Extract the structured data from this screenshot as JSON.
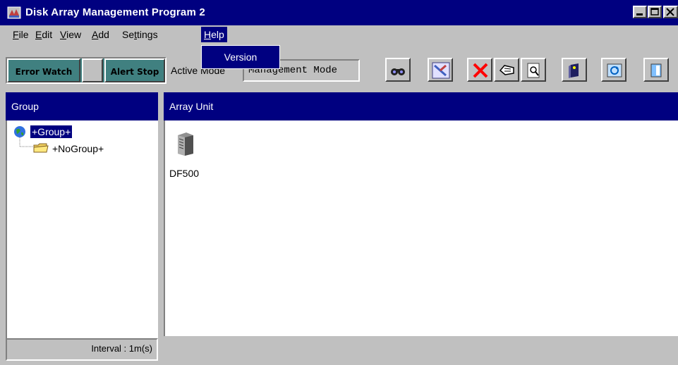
{
  "window": {
    "title": "Disk Array Management Program 2",
    "controls": [
      "minimize-icon",
      "maximize-icon",
      "close-icon"
    ]
  },
  "menubar": {
    "items": [
      {
        "label": "File",
        "mnemonic": "F"
      },
      {
        "label": "Edit",
        "mnemonic": "E"
      },
      {
        "label": "View",
        "mnemonic": "V"
      },
      {
        "label": "Add",
        "mnemonic": "A"
      },
      {
        "label": "Settings",
        "mnemonic": "t"
      },
      {
        "label": "Help",
        "mnemonic": "H"
      }
    ],
    "open_menu": "Help",
    "dropdown": {
      "items": [
        "Version"
      ]
    }
  },
  "toolbar": {
    "error_watch": "Error Watch",
    "alert_stop": "Alert Stop",
    "active_mode_label": "Active Mode",
    "active_mode_value": "Management Mode",
    "buttons": [
      "search-icon",
      "connect-icon",
      "delete-icon",
      "hand-icon",
      "inspect-icon",
      "book-icon",
      "refresh-icon",
      "exit-icon"
    ]
  },
  "group_pane": {
    "header": "Group",
    "tree": {
      "root": "+Group+",
      "children": [
        "+NoGroup+"
      ]
    }
  },
  "array_pane": {
    "header": "Array Unit",
    "units": [
      {
        "label": "DF500",
        "icon": "disk-array-icon"
      }
    ]
  },
  "statusbar": {
    "interval": "Interval : 1m(s)"
  },
  "colors": {
    "titlebar": "#000080",
    "face": "#c0c0c0",
    "selection": "#000080",
    "toggle": "#408080"
  }
}
